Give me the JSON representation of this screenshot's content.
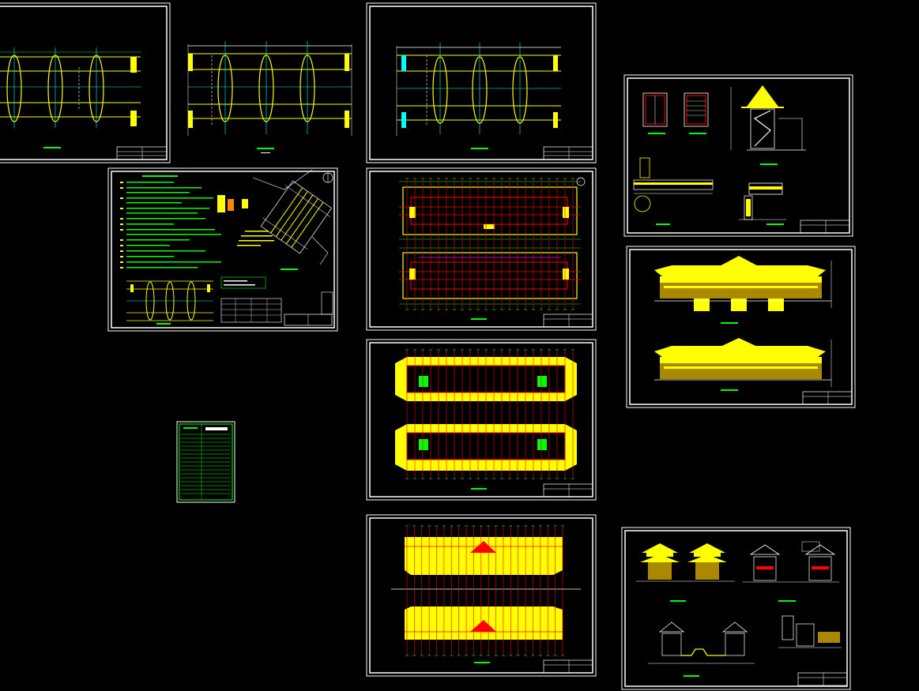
{
  "canvas": {
    "background": "#000000"
  },
  "colors": {
    "frame": "#ffffff",
    "yellow": "#ffff00",
    "green": "#00ff00",
    "cyan": "#00ffff",
    "red": "#ff0000",
    "magenta": "#ff00ff"
  },
  "sheets": [
    {
      "id": "bridge-plan-a",
      "kind": "bridge-plan"
    },
    {
      "id": "bridge-plan-b",
      "kind": "bridge-plan"
    },
    {
      "id": "bridge-plan-c",
      "kind": "bridge-plan"
    },
    {
      "id": "design-notes",
      "kind": "notes"
    },
    {
      "id": "floor-plan-1",
      "kind": "floor-plan"
    },
    {
      "id": "floor-plan-2",
      "kind": "floor-plan"
    },
    {
      "id": "roof-plan",
      "kind": "roof-plan"
    },
    {
      "id": "pavilion-details",
      "kind": "detail"
    },
    {
      "id": "elevations",
      "kind": "elevation"
    },
    {
      "id": "sections",
      "kind": "section"
    },
    {
      "id": "drawing-index",
      "kind": "index"
    }
  ]
}
